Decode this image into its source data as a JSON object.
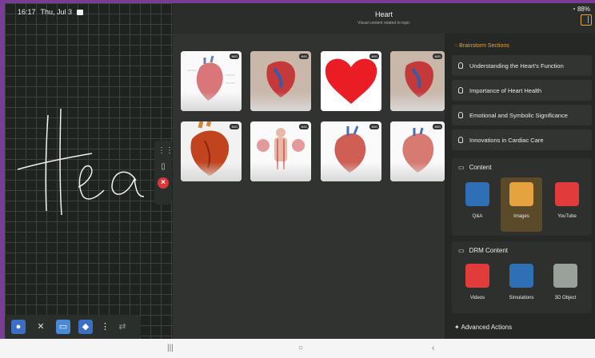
{
  "status": {
    "time": "16:17",
    "date": "Thu, Jul 3",
    "battery": "88%"
  },
  "header": {
    "title": "Heart",
    "subtitle": "Visual content related to topic"
  },
  "image_cards": [
    {
      "badge": "IMG",
      "kind": "diagram"
    },
    {
      "badge": "IMG",
      "kind": "anatomy"
    },
    {
      "badge": "IMG",
      "kind": "symbol"
    },
    {
      "badge": "IMG",
      "kind": "anatomy"
    },
    {
      "badge": "IMG",
      "kind": "realistic"
    },
    {
      "badge": "IMG",
      "kind": "body"
    },
    {
      "badge": "IMG",
      "kind": "diagram"
    },
    {
      "badge": "IMG",
      "kind": "diagram"
    }
  ],
  "brainstorm": {
    "title": "Brainstorm Sections",
    "items": [
      "Understanding the Heart's Function",
      "Importance of Heart Health",
      "Emotional and Symbolic Significance",
      "Innovations in Cardiac Care"
    ]
  },
  "content": {
    "title": "Content",
    "tiles": [
      {
        "label": "Q&A",
        "icon": "qa-icon",
        "color": "#2f6fb5"
      },
      {
        "label": "Images",
        "icon": "image-icon",
        "color": "#e5a340"
      },
      {
        "label": "YouTube",
        "icon": "youtube-icon",
        "color": "#e23b3b"
      }
    ]
  },
  "drm": {
    "title": "DRM Content",
    "tiles": [
      {
        "label": "Videos",
        "icon": "play-icon",
        "color": "#e23b3b"
      },
      {
        "label": "Simulations",
        "icon": "atom-icon",
        "color": "#2f6fb5"
      },
      {
        "label": "3D Object",
        "icon": "cube-icon",
        "color": "#9aa09a"
      }
    ]
  },
  "advanced": {
    "title": "Advanced Actions"
  },
  "accent": "#e5a340"
}
